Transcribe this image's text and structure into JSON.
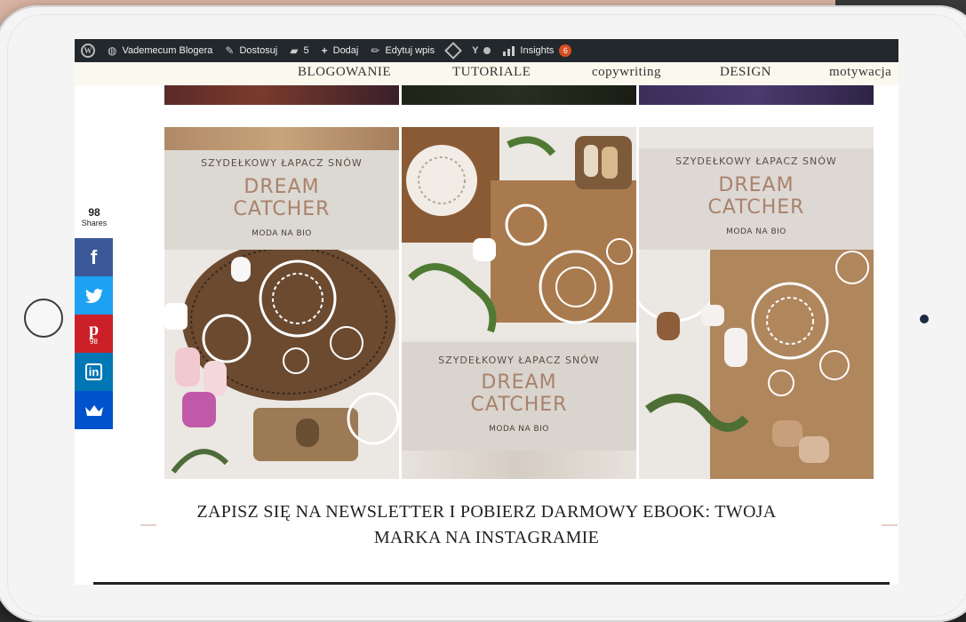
{
  "admin_bar": {
    "site_name": "Vademecum Blogera",
    "customize": "Dostosuj",
    "comments_count": "5",
    "add_new": "Dodaj",
    "edit_post": "Edytuj wpis",
    "insights": "Insights",
    "insights_badge": "6"
  },
  "nav": {
    "items": [
      "BLOGOWANIE",
      "TUTORIALE",
      "copywriting",
      "DESIGN",
      "motywacja"
    ]
  },
  "share": {
    "count": "98",
    "label": "Shares",
    "pinterest_count": "98",
    "colors": {
      "facebook": "#3b5998",
      "twitter": "#1da1f2",
      "pinterest": "#cb2027",
      "linkedin": "#0077b5",
      "crown": "#0052cc"
    }
  },
  "pins": [
    {
      "kicker": "SZYDEŁKOWY ŁAPACZ SNÓW",
      "title_line1": "DREAM",
      "title_line2": "CATCHER",
      "subtitle": "MODA NA BIO"
    },
    {
      "kicker": "SZYDEŁKOWY ŁAPACZ SNÓW",
      "title_line1": "DREAM",
      "title_line2": "CATCHER",
      "subtitle": "MODA NA BIO"
    },
    {
      "kicker": "SZYDEŁKOWY ŁAPACZ SNÓW",
      "title_line1": "DREAM",
      "title_line2": "CATCHER",
      "subtitle": "MODA NA BIO"
    }
  ],
  "newsletter": {
    "line1": "ZAPISZ SIĘ NA NEWSLETTER I POBIERZ DARMOWY EBOOK: TWOJA",
    "line2": "MARKA NA INSTAGRAMIE"
  }
}
